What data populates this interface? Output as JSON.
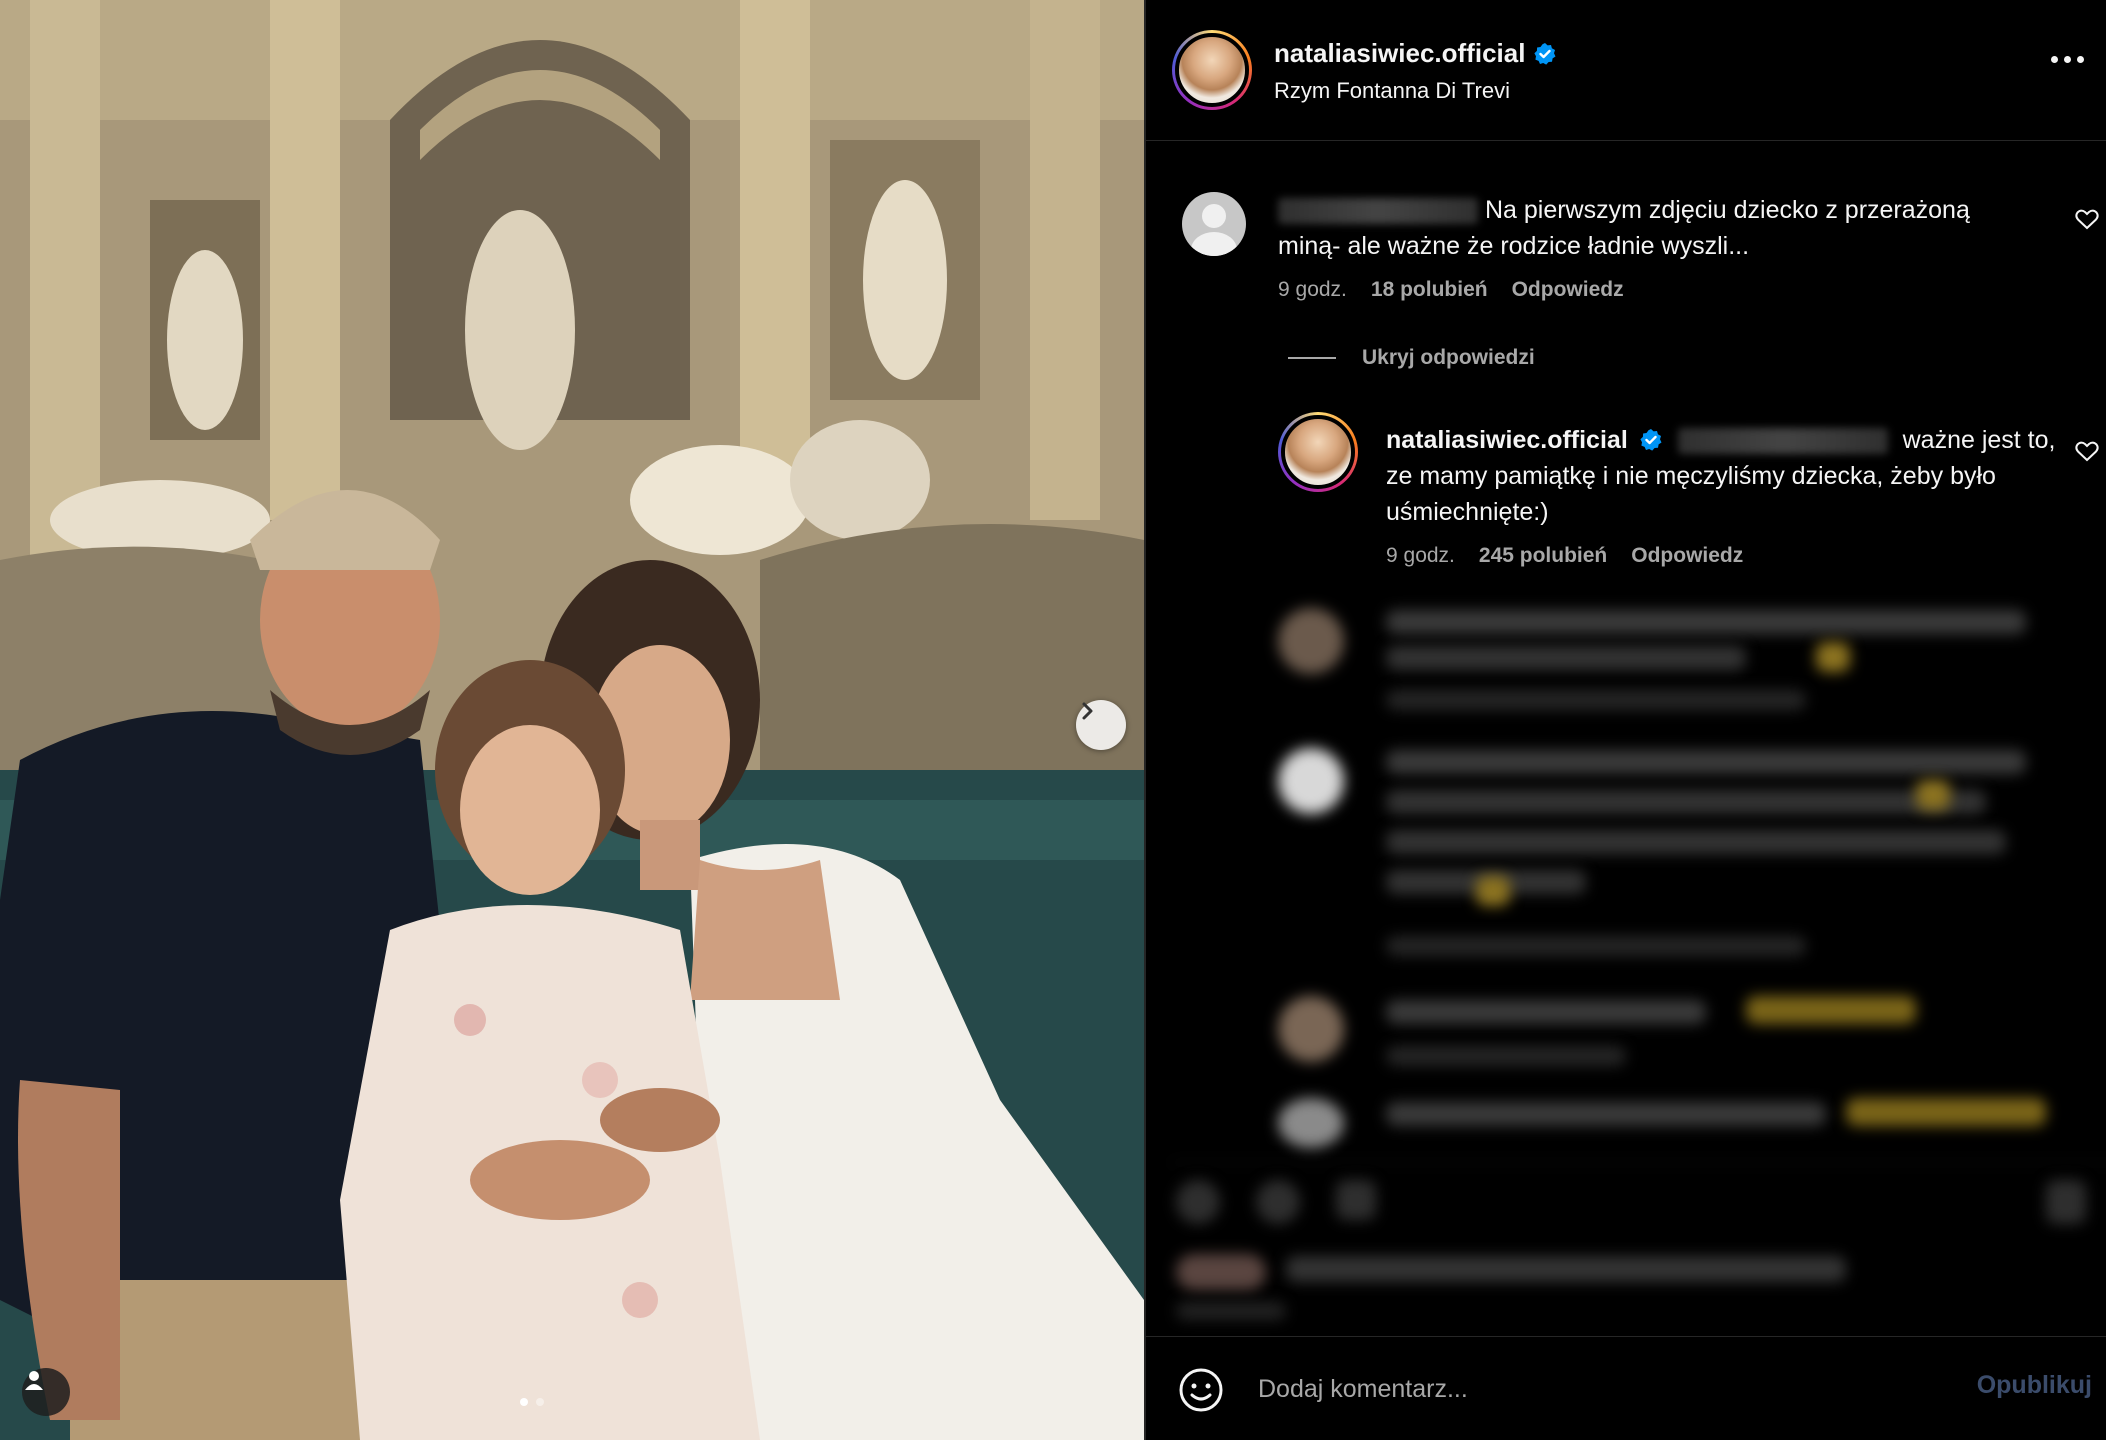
{
  "post": {
    "username": "nataliasiwiec.official",
    "location": "Rzym Fontanna Di Trevi",
    "verified": true
  },
  "comments": [
    {
      "username_blurred": true,
      "text": "Na pierwszym zdjęciu dziecko z przerażoną miną- ale ważne że rodzice ładnie wyszli...",
      "time": "9 godz.",
      "likes": "18 polubień",
      "reply_label": "Odpowiedz",
      "replies_toggle": "Ukryj odpowiedzi",
      "replies": [
        {
          "username": "nataliasiwiec.official",
          "mention_blurred": true,
          "text": "ważne jest to, ze mamy pamiątkę i nie męczyliśmy dziecka, żeby było uśmiechnięte:)",
          "time": "9 godz.",
          "likes": "245 polubień",
          "reply_label": "Odpowiedz"
        }
      ]
    }
  ],
  "composer": {
    "placeholder": "Dodaj komentarz...",
    "publish_label": "Opublikuj"
  },
  "icons": {
    "verified": "verified-badge-icon",
    "more": "more-options-icon",
    "like": "heart-icon",
    "emoji": "emoji-icon",
    "next": "chevron-right-icon",
    "tag": "user-tag-icon"
  },
  "colors": {
    "verified_blue": "#0095f6",
    "publish_disabled": "#3b4c6b",
    "secondary_text": "#a8a8a8"
  }
}
